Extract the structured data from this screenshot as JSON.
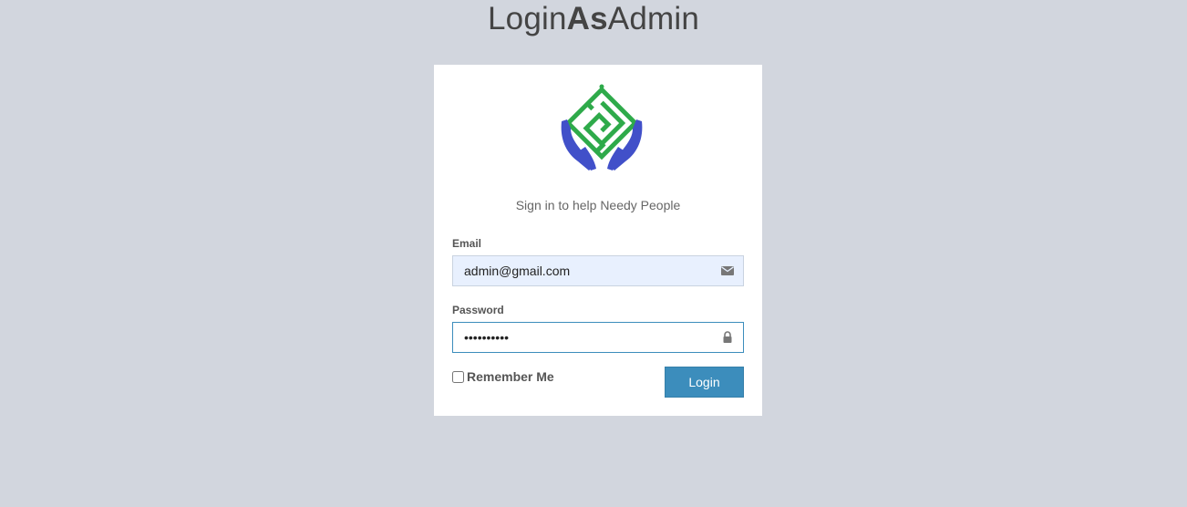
{
  "title": {
    "part1": "Login",
    "part2": "As",
    "part3": "Admin"
  },
  "login": {
    "subtitle": "Sign in to help Needy People",
    "email": {
      "label": "Email",
      "value": "admin@gmail.com",
      "icon": "envelope-icon"
    },
    "password": {
      "label": "Password",
      "masked_value": "••••••••••",
      "icon": "lock-icon"
    },
    "remember_label": "Remember Me",
    "remember_checked": false,
    "submit_label": "Login"
  },
  "colors": {
    "background": "#d2d6de",
    "primary": "#3c8dbc",
    "logo_green": "#2eaa4a",
    "logo_blue": "#4150c9",
    "email_field_bg": "#e8f0fe"
  }
}
